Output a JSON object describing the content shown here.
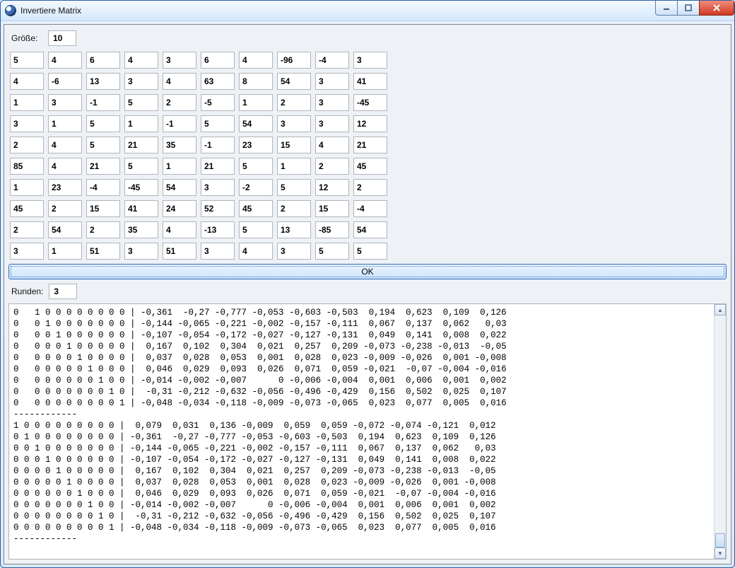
{
  "window": {
    "title": "Invertiere Matrix"
  },
  "labels": {
    "size": "Größe:",
    "round": "Runden:",
    "ok": "OK"
  },
  "values": {
    "size": "10",
    "round": "3"
  },
  "matrix": [
    [
      "5",
      "4",
      "6",
      "4",
      "3",
      "6",
      "4",
      "-96",
      "-4",
      "3"
    ],
    [
      "4",
      "-6",
      "13",
      "3",
      "4",
      "63",
      "8",
      "54",
      "3",
      "41"
    ],
    [
      "1",
      "3",
      "-1",
      "5",
      "2",
      "-5",
      "1",
      "2",
      "3",
      "-45"
    ],
    [
      "3",
      "1",
      "5",
      "1",
      "-1",
      "5",
      "54",
      "3",
      "3",
      "12"
    ],
    [
      "2",
      "4",
      "5",
      "21",
      "35",
      "-1",
      "23",
      "15",
      "4",
      "21"
    ],
    [
      "85",
      "4",
      "21",
      "5",
      "1",
      "21",
      "5",
      "1",
      "2",
      "45"
    ],
    [
      "1",
      "23",
      "-4",
      "-45",
      "54",
      "3",
      "-2",
      "5",
      "12",
      "2"
    ],
    [
      "45",
      "2",
      "15",
      "41",
      "24",
      "52",
      "45",
      "2",
      "15",
      "-4"
    ],
    [
      "2",
      "54",
      "2",
      "35",
      "4",
      "-13",
      "5",
      "13",
      "-85",
      "54"
    ],
    [
      "3",
      "1",
      "51",
      "3",
      "51",
      "3",
      "4",
      "3",
      "5",
      "5"
    ]
  ],
  "output": "0   1 0 0 0 0 0 0 0 0 | -0,361  -0,27 -0,777 -0,053 -0,603 -0,503  0,194  0,623  0,109  0,126\n0   0 1 0 0 0 0 0 0 0 | -0,144 -0,065 -0,221 -0,002 -0,157 -0,111  0,067  0,137  0,062   0,03\n0   0 0 1 0 0 0 0 0 0 | -0,107 -0,054 -0,172 -0,027 -0,127 -0,131  0,049  0,141  0,008  0,022\n0   0 0 0 1 0 0 0 0 0 |  0,167  0,102  0,304  0,021  0,257  0,209 -0,073 -0,238 -0,013  -0,05\n0   0 0 0 0 1 0 0 0 0 |  0,037  0,028  0,053  0,001  0,028  0,023 -0,009 -0,026  0,001 -0,008\n0   0 0 0 0 0 1 0 0 0 |  0,046  0,029  0,093  0,026  0,071  0,059 -0,021  -0,07 -0,004 -0,016\n0   0 0 0 0 0 0 1 0 0 | -0,014 -0,002 -0,007      0 -0,006 -0,004  0,001  0,006  0,001  0,002\n0   0 0 0 0 0 0 0 1 0 |  -0,31 -0,212 -0,632 -0,056 -0,496 -0,429  0,156  0,502  0,025  0,107\n0   0 0 0 0 0 0 0 0 1 | -0,048 -0,034 -0,118 -0,009 -0,073 -0,065  0,023  0,077  0,005  0,016\n------------\n1 0 0 0 0 0 0 0 0 0 |  0,079  0,031  0,136 -0,009  0,059  0,059 -0,072 -0,074 -0,121  0,012\n0 1 0 0 0 0 0 0 0 0 | -0,361  -0,27 -0,777 -0,053 -0,603 -0,503  0,194  0,623  0,109  0,126\n0 0 1 0 0 0 0 0 0 0 | -0,144 -0,065 -0,221 -0,002 -0,157 -0,111  0,067  0,137  0,062   0,03\n0 0 0 1 0 0 0 0 0 0 | -0,107 -0,054 -0,172 -0,027 -0,127 -0,131  0,049  0,141  0,008  0,022\n0 0 0 0 1 0 0 0 0 0 |  0,167  0,102  0,304  0,021  0,257  0,209 -0,073 -0,238 -0,013  -0,05\n0 0 0 0 0 1 0 0 0 0 |  0,037  0,028  0,053  0,001  0,028  0,023 -0,009 -0,026  0,001 -0,008\n0 0 0 0 0 0 1 0 0 0 |  0,046  0,029  0,093  0,026  0,071  0,059 -0,021  -0,07 -0,004 -0,016\n0 0 0 0 0 0 0 1 0 0 | -0,014 -0,002 -0,007      0 -0,006 -0,004  0,001  0,006  0,001  0,002\n0 0 0 0 0 0 0 0 1 0 |  -0,31 -0,212 -0,632 -0,056 -0,496 -0,429  0,156  0,502  0,025  0,107\n0 0 0 0 0 0 0 0 0 1 | -0,048 -0,034 -0,118 -0,009 -0,073 -0,065  0,023  0,077  0,005  0,016\n------------"
}
